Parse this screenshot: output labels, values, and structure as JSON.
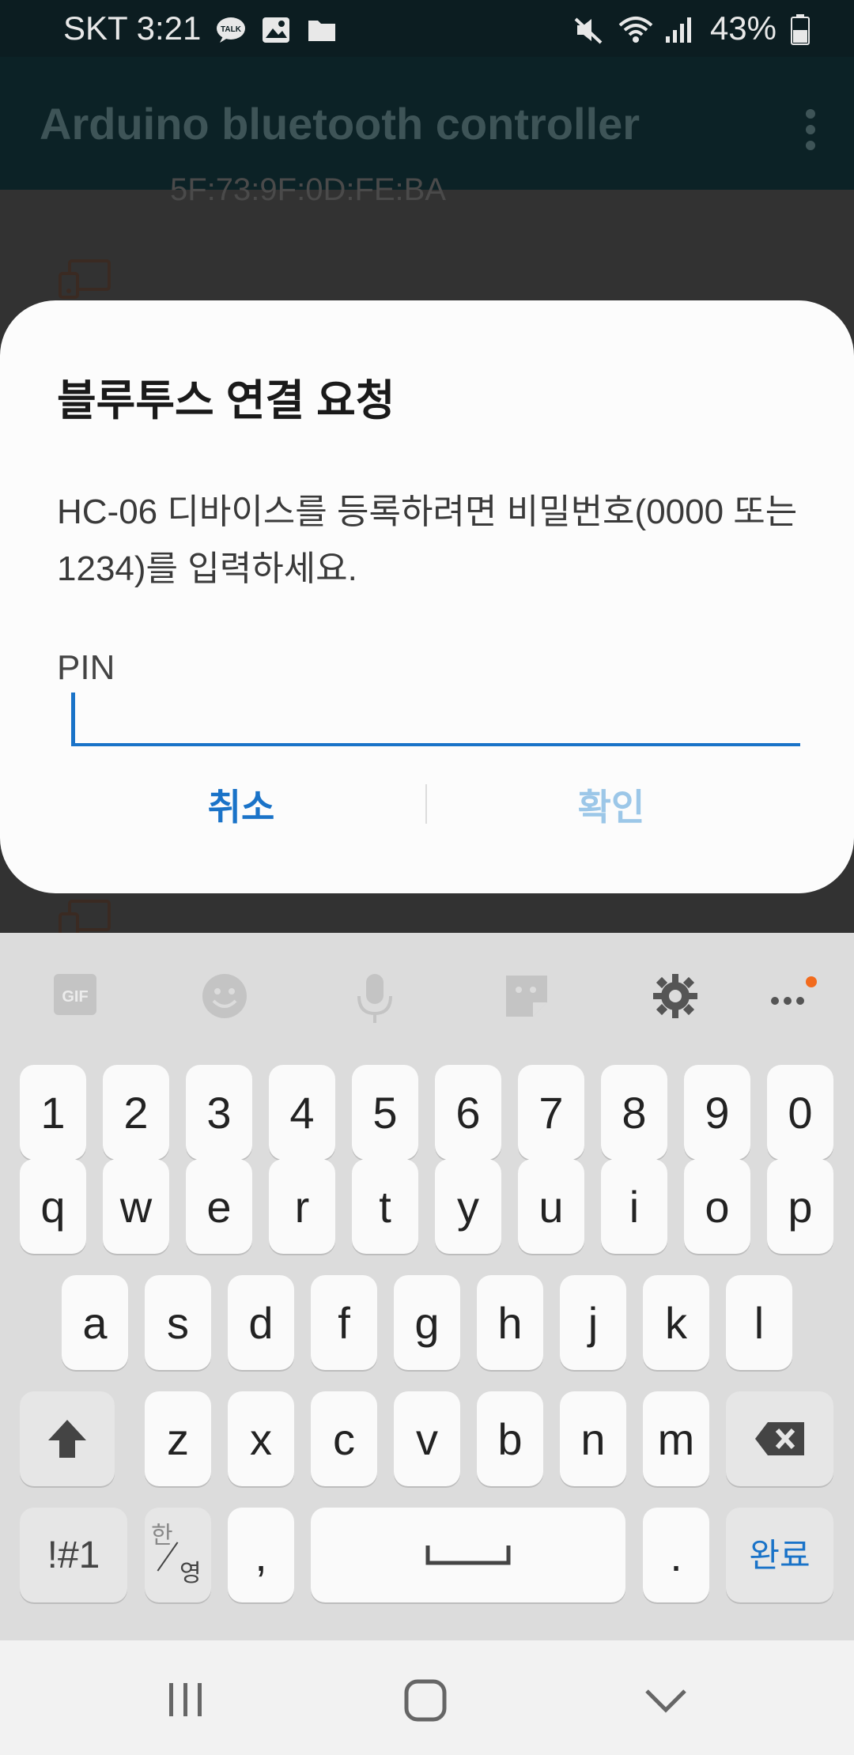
{
  "status_bar": {
    "carrier_time": "SKT 3:21",
    "battery": "43%"
  },
  "app_bar": {
    "title": "Arduino bluetooth controller"
  },
  "background_list": {
    "mac_partial": "5F:73:9F:0D:FE:BA"
  },
  "dialog": {
    "title": "블루투스 연결 요청",
    "message": "HC-06 디바이스를 등록하려면 비밀번호(0000 또는 1234)를 입력하세요.",
    "pin_label": "PIN",
    "pin_value": "",
    "cancel_label": "취소",
    "ok_label": "확인"
  },
  "keyboard": {
    "toolbar": [
      "gif-icon",
      "emoji-icon",
      "microphone-icon",
      "sticker-icon",
      "settings-icon",
      "more-icon"
    ],
    "gif_label": "GIF",
    "row_numbers": [
      "1",
      "2",
      "3",
      "4",
      "5",
      "6",
      "7",
      "8",
      "9",
      "0"
    ],
    "row_q": [
      "q",
      "w",
      "e",
      "r",
      "t",
      "y",
      "u",
      "i",
      "o",
      "p"
    ],
    "row_a": [
      "a",
      "s",
      "d",
      "f",
      "g",
      "h",
      "j",
      "k",
      "l"
    ],
    "row_z": [
      "z",
      "x",
      "c",
      "v",
      "b",
      "n",
      "m"
    ],
    "symbols_label": "!#1",
    "lang_top": "한",
    "lang_bottom": "영",
    "comma": ",",
    "period": ".",
    "done_label": "완료"
  },
  "nav_bar": {
    "icons": [
      "recent-apps-icon",
      "home-icon",
      "back-icon"
    ]
  }
}
